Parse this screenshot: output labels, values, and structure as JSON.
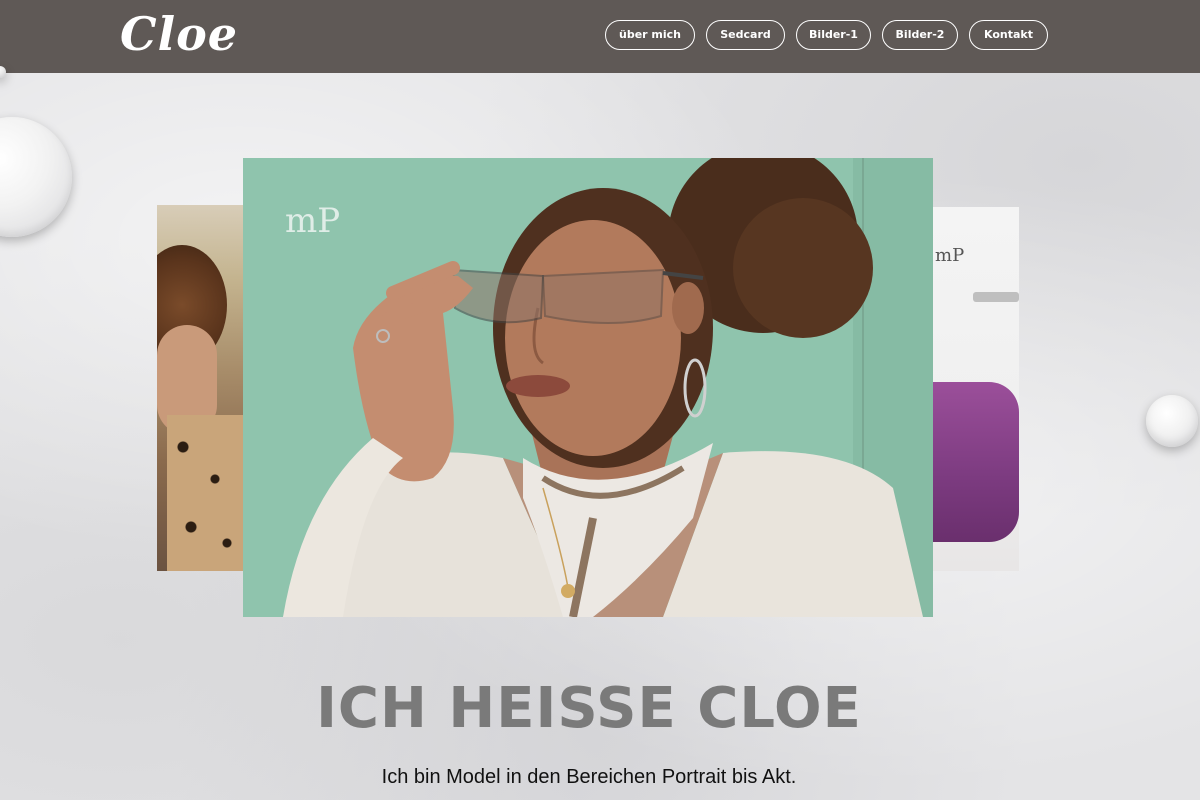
{
  "header": {
    "logo_text": "Cloe",
    "nav": [
      {
        "label": "über mich"
      },
      {
        "label": "Sedcard"
      },
      {
        "label": "Bilder-1"
      },
      {
        "label": "Bilder-2"
      },
      {
        "label": "Kontakt"
      }
    ]
  },
  "carousel": {
    "watermark": "mP"
  },
  "hero": {
    "title": "ICH HEISSE CLOE",
    "subtitle": "Ich bin Model in den Bereichen Portrait bis Akt."
  },
  "colors": {
    "header_bg": "#5f5956",
    "title_gray": "#7a7a7a",
    "slide_mint": "#8fc4ad"
  }
}
